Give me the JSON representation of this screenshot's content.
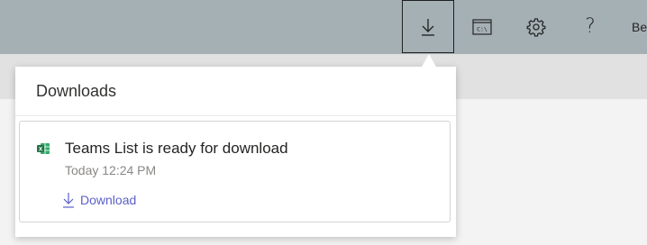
{
  "topbar": {
    "buttons": [
      {
        "name": "download-button",
        "icon": "download-arrow-icon"
      },
      {
        "name": "admin-console-button",
        "icon": "command-prompt-icon",
        "icon_text": "C:\\"
      },
      {
        "name": "settings-button",
        "icon": "gear-icon"
      },
      {
        "name": "help-button",
        "icon": "question-mark-icon",
        "icon_text": "?"
      }
    ],
    "user_partial": "Be"
  },
  "downloads_panel": {
    "title": "Downloads",
    "items": [
      {
        "icon": "excel-icon",
        "icon_letter": "X",
        "title": "Teams List is ready for download",
        "time": "Today 12:24 PM",
        "action_label": "Download"
      }
    ]
  },
  "colors": {
    "topbar": "#a5b0b5",
    "link": "#5b5fc7",
    "excel_green": "#217346"
  }
}
